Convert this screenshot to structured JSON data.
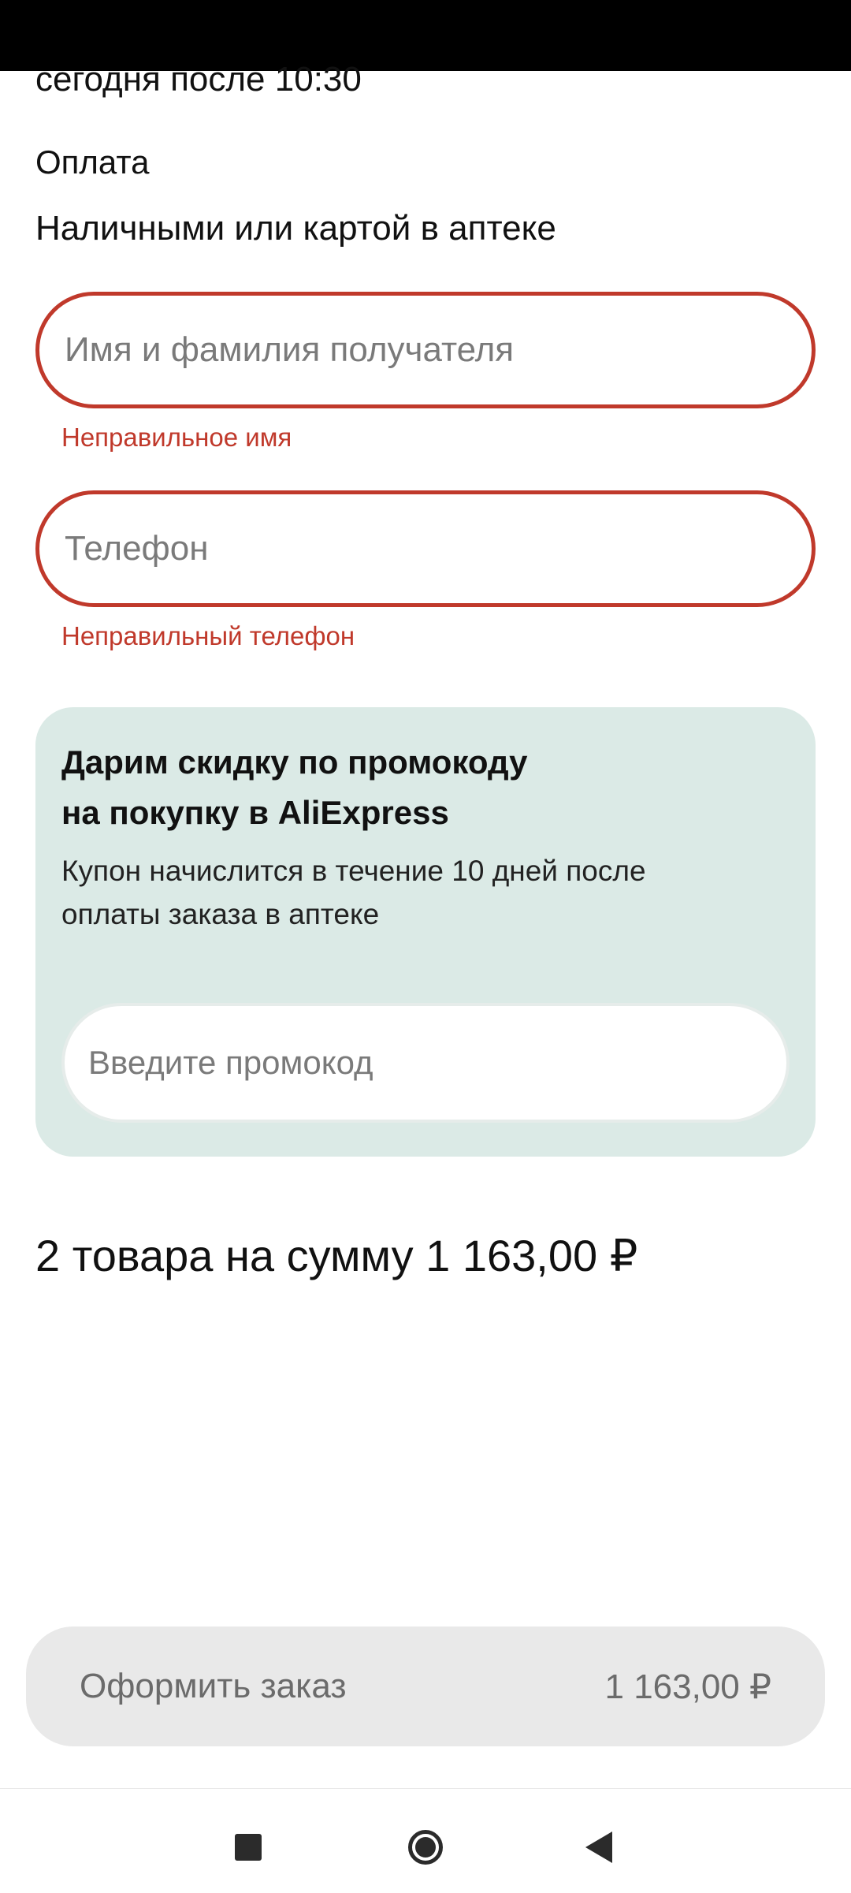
{
  "delivery": {
    "time": "сегодня после 10:30"
  },
  "payment": {
    "label": "Оплата",
    "value": "Наличными или картой в аптеке"
  },
  "form": {
    "name": {
      "placeholder": "Имя и фамилия получателя",
      "error": "Неправильное имя"
    },
    "phone": {
      "placeholder": "Телефон",
      "error": "Неправильный телефон"
    },
    "error_color": "#c0392b"
  },
  "promo": {
    "title_line1": "Дарим скидку по промокоду",
    "title_line2": "на покупку в AliExpress",
    "description_line1": "Купон начислится в течение 10 дней после",
    "description_line2": "оплаты заказа в аптеке",
    "placeholder": "Введите промокод",
    "background": "#dbeae6"
  },
  "summary": {
    "total_text": "2 товара на сумму 1 163,00 ₽"
  },
  "checkout": {
    "label": "Оформить заказ",
    "price": "1 163,00 ₽"
  },
  "navigation": {
    "recent_icon": "square-icon",
    "home_icon": "circle-home-icon",
    "back_icon": "triangle-back-icon"
  }
}
